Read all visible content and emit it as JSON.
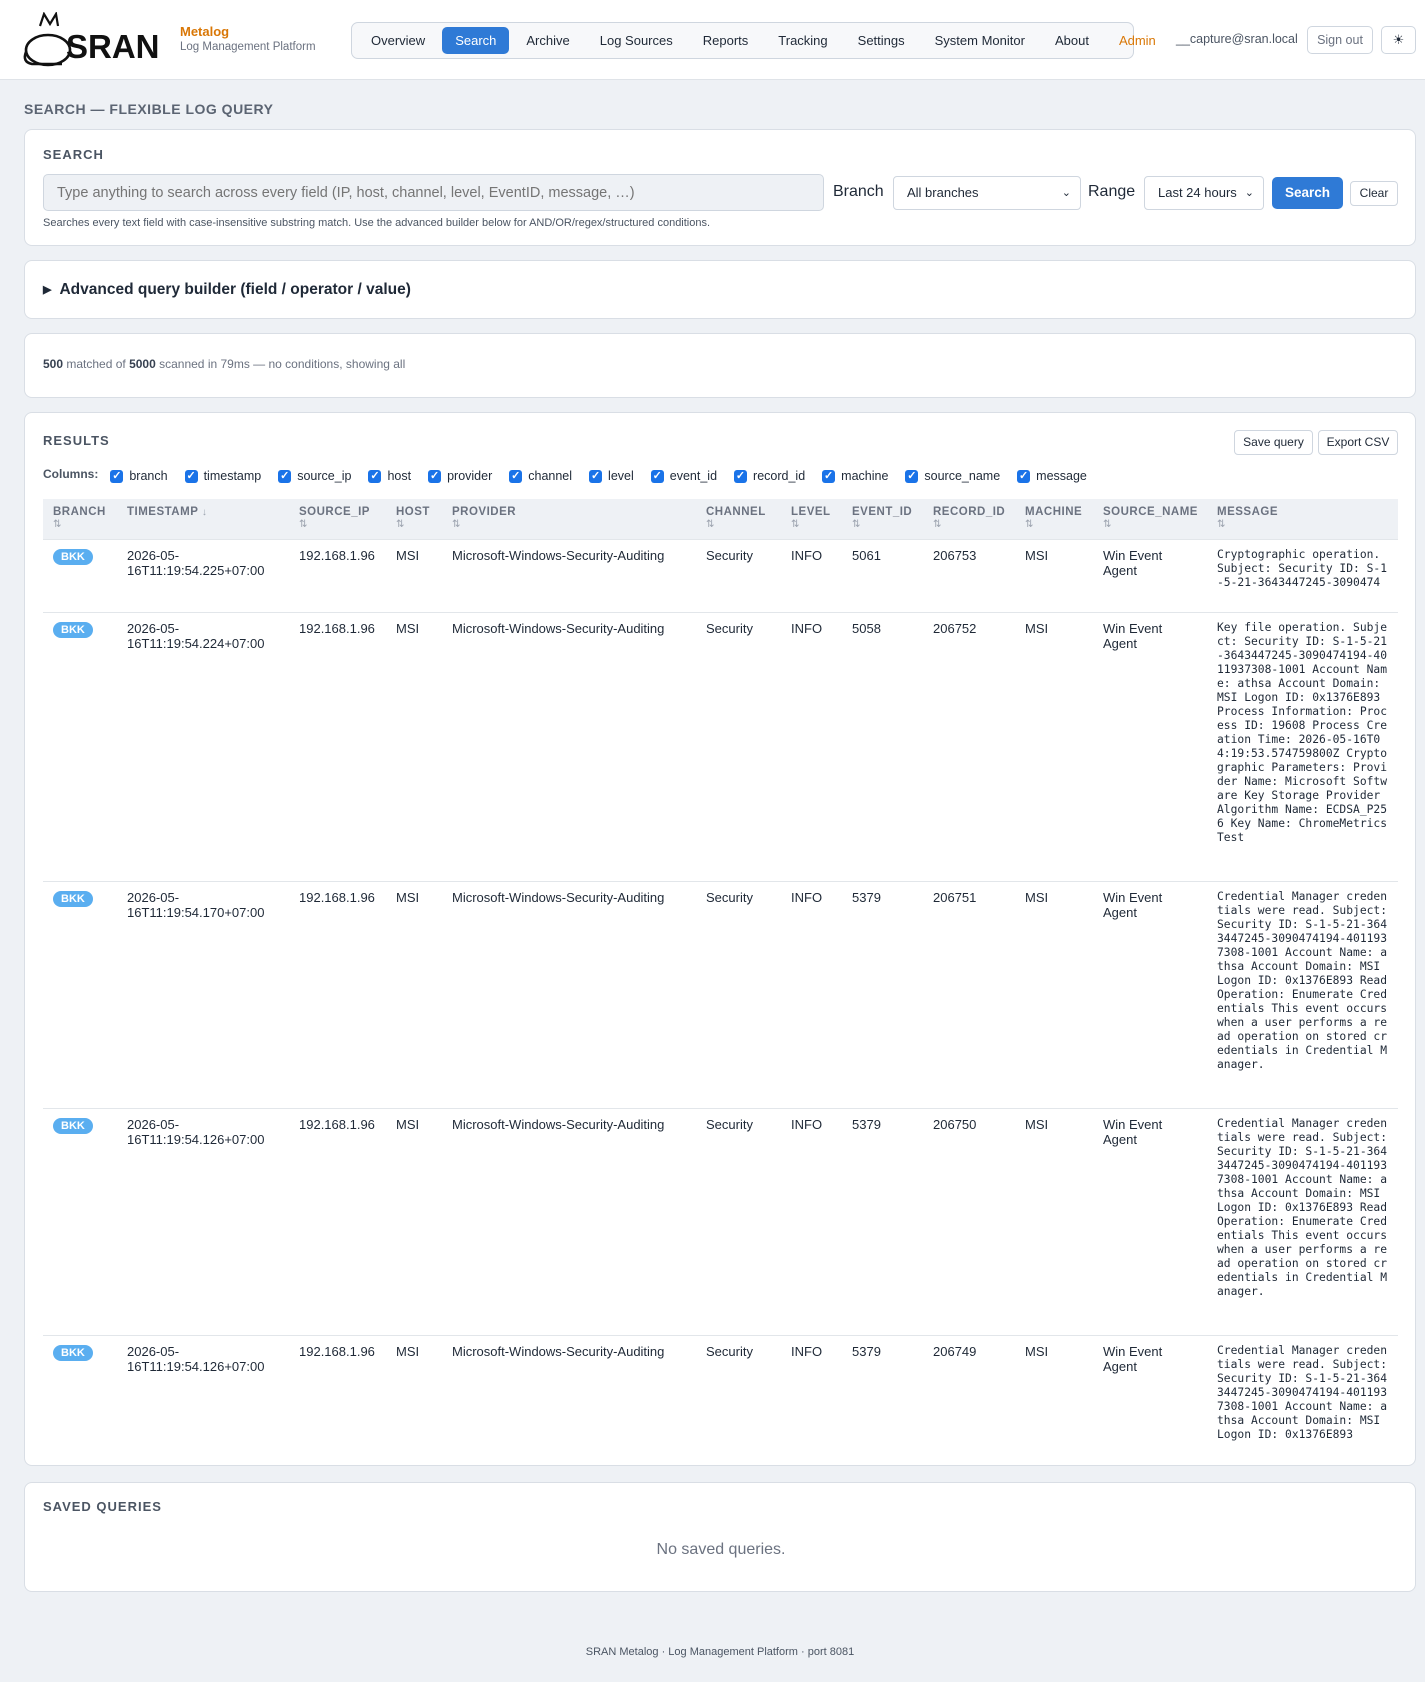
{
  "app": {
    "logo_text": "SRAN",
    "name": "Metalog",
    "subtitle": "Log Management Platform"
  },
  "nav": [
    {
      "label": "Overview",
      "name": "nav-overview"
    },
    {
      "label": "Search",
      "name": "nav-search",
      "active": true
    },
    {
      "label": "Archive",
      "name": "nav-archive"
    },
    {
      "label": "Log Sources",
      "name": "nav-log-sources"
    },
    {
      "label": "Reports",
      "name": "nav-reports"
    },
    {
      "label": "Tracking",
      "name": "nav-tracking"
    },
    {
      "label": "Settings",
      "name": "nav-settings"
    },
    {
      "label": "System Monitor",
      "name": "nav-system-monitor"
    },
    {
      "label": "About",
      "name": "nav-about"
    },
    {
      "label": "Admin",
      "name": "nav-admin",
      "admin": true
    }
  ],
  "header": {
    "user": "__capture@sran.local",
    "signout_label": "Sign out",
    "theme_icon": "☀"
  },
  "page_title": "SEARCH — FLEXIBLE LOG QUERY",
  "search": {
    "title": "SEARCH",
    "placeholder": "Type anything to search across every field (IP, host, channel, level, EventID, message, …)",
    "branch_label": "Branch",
    "branch_value": "All branches",
    "range_label": "Range",
    "range_value": "Last 24 hours",
    "search_button": "Search",
    "clear_button": "Clear",
    "hint": "Searches every text field with case-insensitive substring match. Use the advanced builder below for AND/OR/regex/structured conditions."
  },
  "advanced": {
    "label": "Advanced query builder (field / operator / value)"
  },
  "stats": {
    "matched": "500",
    "matched_text": " matched of ",
    "scanned": "5000",
    "tail": " scanned in 79ms — no conditions, showing all"
  },
  "results": {
    "title": "RESULTS",
    "save_query": "Save query",
    "export_csv": "Export CSV",
    "columns_label": "Columns:",
    "column_toggles": [
      "branch",
      "timestamp",
      "source_ip",
      "host",
      "provider",
      "channel",
      "level",
      "event_id",
      "record_id",
      "machine",
      "source_name",
      "message"
    ],
    "headers": [
      {
        "label": "BRANCH",
        "sort": "⇅"
      },
      {
        "label": "TIMESTAMP",
        "sort": "↓"
      },
      {
        "label": "SOURCE_IP",
        "sort": "⇅"
      },
      {
        "label": "HOST",
        "sort": "⇅"
      },
      {
        "label": "PROVIDER",
        "sort": "⇅"
      },
      {
        "label": "CHANNEL",
        "sort": "⇅"
      },
      {
        "label": "LEVEL",
        "sort": "⇅"
      },
      {
        "label": "EVENT_ID",
        "sort": "⇅"
      },
      {
        "label": "RECORD_ID",
        "sort": "⇅"
      },
      {
        "label": "MACHINE",
        "sort": "⇅"
      },
      {
        "label": "SOURCE_NAME",
        "sort": "⇅"
      },
      {
        "label": "MESSAGE",
        "sort": "⇅"
      }
    ],
    "rows": [
      {
        "branch": "BKK",
        "timestamp": "2026-05-16T11:19:54.225+07:00",
        "source_ip": "192.168.1.96",
        "host": "MSI",
        "provider": "Microsoft-Windows-Security-Auditing",
        "channel": "Security",
        "level": "INFO",
        "event_id": "5061",
        "record_id": "206753",
        "machine": "MSI",
        "source_name": "Win Event Agent",
        "message": "Cryptographic operation. Subject: Security ID: S-1-5-21-3643447245-3090474"
      },
      {
        "branch": "BKK",
        "timestamp": "2026-05-16T11:19:54.224+07:00",
        "source_ip": "192.168.1.96",
        "host": "MSI",
        "provider": "Microsoft-Windows-Security-Auditing",
        "channel": "Security",
        "level": "INFO",
        "event_id": "5058",
        "record_id": "206752",
        "machine": "MSI",
        "source_name": "Win Event Agent",
        "message": "Key file operation. Subject: Security ID: S-1-5-21-3643447245-3090474194-4011937308-1001 Account Name: athsa Account Domain: MSI Logon ID: 0x1376E893 Process Information: Process ID: 19608 Process Creation Time: 2026-05-16T04:19:53.574759800Z Cryptographic Parameters: Provider Name: Microsoft Software Key Storage Provider Algorithm Name: ECDSA_P256 Key Name: ChromeMetricsTest"
      },
      {
        "branch": "BKK",
        "timestamp": "2026-05-16T11:19:54.170+07:00",
        "source_ip": "192.168.1.96",
        "host": "MSI",
        "provider": "Microsoft-Windows-Security-Auditing",
        "channel": "Security",
        "level": "INFO",
        "event_id": "5379",
        "record_id": "206751",
        "machine": "MSI",
        "source_name": "Win Event Agent",
        "message": "Credential Manager credentials were read. Subject: Security ID: S-1-5-21-3643447245-3090474194-4011937308-1001 Account Name: athsa Account Domain: MSI Logon ID: 0x1376E893 Read Operation: Enumerate Credentials This event occurs when a user performs a read operation on stored credentials in Credential Manager."
      },
      {
        "branch": "BKK",
        "timestamp": "2026-05-16T11:19:54.126+07:00",
        "source_ip": "192.168.1.96",
        "host": "MSI",
        "provider": "Microsoft-Windows-Security-Auditing",
        "channel": "Security",
        "level": "INFO",
        "event_id": "5379",
        "record_id": "206750",
        "machine": "MSI",
        "source_name": "Win Event Agent",
        "message": "Credential Manager credentials were read. Subject: Security ID: S-1-5-21-3643447245-3090474194-4011937308-1001 Account Name: athsa Account Domain: MSI Logon ID: 0x1376E893 Read Operation: Enumerate Credentials This event occurs when a user performs a read operation on stored credentials in Credential Manager."
      },
      {
        "branch": "BKK",
        "timestamp": "2026-05-16T11:19:54.126+07:00",
        "source_ip": "192.168.1.96",
        "host": "MSI",
        "provider": "Microsoft-Windows-Security-Auditing",
        "channel": "Security",
        "level": "INFO",
        "event_id": "5379",
        "record_id": "206749",
        "machine": "MSI",
        "source_name": "Win Event Agent",
        "message": "Credential Manager credentials were read. Subject: Security ID: S-1-5-21-3643447245-3090474194-4011937308-1001 Account Name: athsa Account Domain: MSI Logon ID: 0x1376E893"
      }
    ]
  },
  "saved": {
    "title": "SAVED QUERIES",
    "empty": "No saved queries."
  },
  "footer": "SRAN Metalog · Log Management Platform · port 8081",
  "colors": {
    "accent": "#2f7ad6",
    "brand": "#d97706",
    "badge": "#5aaef0"
  }
}
